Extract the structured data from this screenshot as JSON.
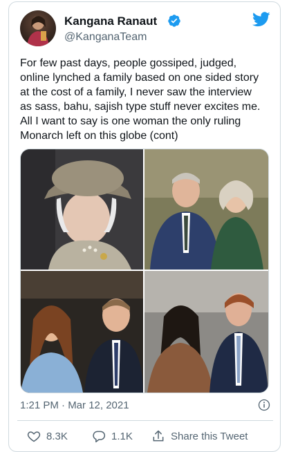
{
  "tweet": {
    "display_name": "Kangana Ranaut",
    "handle": "@KanganaTeam",
    "text": "For few past days, people gossiped, judged,\nonline lynched a family based on one sided story\nat the cost of a family, I never saw the interview\nas sass, bahu, sajish type stuff never excites me.\nAll I want to say is one woman the only ruling\nMonarch left on this globe (cont)",
    "timestamp": "1:21 PM · Mar 12, 2021"
  },
  "actions": {
    "like_count": "8.3K",
    "reply_count": "1.1K",
    "share_label": "Share this Tweet"
  },
  "icons": {
    "verified": "verified-badge-icon",
    "brand": "twitter-bird-icon",
    "info": "info-icon",
    "like": "heart-icon",
    "reply": "reply-bubble-icon",
    "share": "share-icon"
  },
  "colors": {
    "accent": "#1d9bf0",
    "text": "#0f1419",
    "muted": "#536471",
    "border": "#cfd9de"
  }
}
